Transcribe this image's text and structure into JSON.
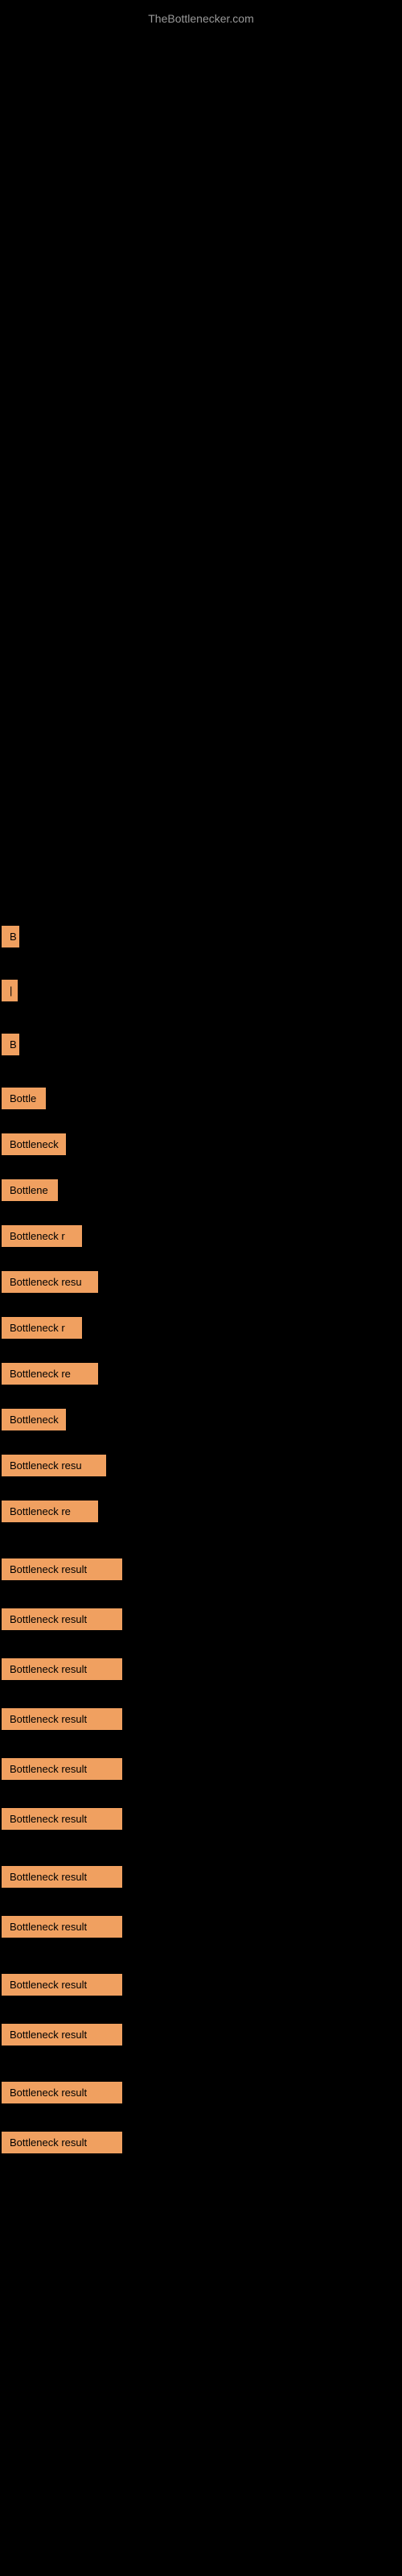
{
  "site": {
    "title": "TheBottlenecker.com"
  },
  "items": [
    {
      "id": 1,
      "label": "B",
      "class": "item-1"
    },
    {
      "id": 2,
      "label": "|",
      "class": "item-2"
    },
    {
      "id": 3,
      "label": "B",
      "class": "item-3"
    },
    {
      "id": 4,
      "label": "Bottle",
      "class": "item-4"
    },
    {
      "id": 5,
      "label": "Bottleneck",
      "class": "item-5"
    },
    {
      "id": 6,
      "label": "Bottlene",
      "class": "item-6"
    },
    {
      "id": 7,
      "label": "Bottleneck r",
      "class": "item-7"
    },
    {
      "id": 8,
      "label": "Bottleneck resu",
      "class": "item-8"
    },
    {
      "id": 9,
      "label": "Bottleneck r",
      "class": "item-9"
    },
    {
      "id": 10,
      "label": "Bottleneck re",
      "class": "item-10"
    },
    {
      "id": 11,
      "label": "Bottleneck",
      "class": "item-11"
    },
    {
      "id": 12,
      "label": "Bottleneck resu",
      "class": "item-12"
    },
    {
      "id": 13,
      "label": "Bottleneck re",
      "class": "item-13"
    },
    {
      "id": 14,
      "label": "Bottleneck result",
      "class": "item-14"
    },
    {
      "id": 15,
      "label": "Bottleneck result",
      "class": "item-15"
    },
    {
      "id": 16,
      "label": "Bottleneck result",
      "class": "item-16"
    },
    {
      "id": 17,
      "label": "Bottleneck result",
      "class": "item-17"
    },
    {
      "id": 18,
      "label": "Bottleneck result",
      "class": "item-18"
    },
    {
      "id": 19,
      "label": "Bottleneck result",
      "class": "item-19"
    },
    {
      "id": 20,
      "label": "Bottleneck result",
      "class": "item-20"
    },
    {
      "id": 21,
      "label": "Bottleneck result",
      "class": "item-21"
    },
    {
      "id": 22,
      "label": "Bottleneck result",
      "class": "item-22"
    },
    {
      "id": 23,
      "label": "Bottleneck result",
      "class": "item-23"
    },
    {
      "id": 24,
      "label": "Bottleneck result",
      "class": "item-24"
    },
    {
      "id": 25,
      "label": "Bottleneck result",
      "class": "item-25"
    }
  ]
}
